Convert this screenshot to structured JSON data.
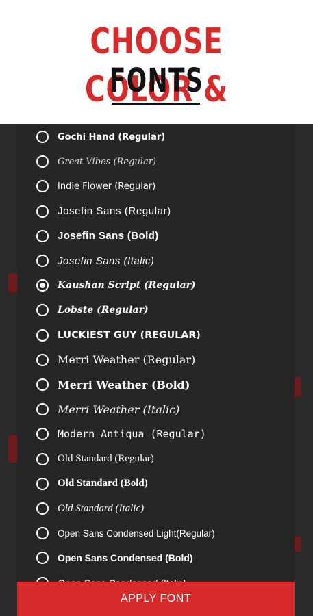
{
  "header": {
    "title_line1": "CHOOSE COLOR &",
    "title_line2": "FONTS"
  },
  "dialog": {
    "fonts": [
      {
        "label": "Gochi Hand (Regular)",
        "selected": false
      },
      {
        "label": "Great Vibes (Regular)",
        "selected": false
      },
      {
        "label": "Indie Flower (Regular)",
        "selected": false
      },
      {
        "label": "Josefin Sans (Regular)",
        "selected": false
      },
      {
        "label": "Josefin Sans (Bold)",
        "selected": false
      },
      {
        "label": "Josefin Sans (Italic)",
        "selected": false
      },
      {
        "label": "Kaushan Script (Regular)",
        "selected": true
      },
      {
        "label": "Lobste (Regular)",
        "selected": false
      },
      {
        "label": "LUCKIEST GUY (REGULAR)",
        "selected": false
      },
      {
        "label": "Merri Weather (Regular)",
        "selected": false
      },
      {
        "label": "Merri Weather (Bold)",
        "selected": false
      },
      {
        "label": "Merri Weather (Italic)",
        "selected": false
      },
      {
        "label": "Modern Antiqua (Regular)",
        "selected": false
      },
      {
        "label": "Old Standard (Regular)",
        "selected": false
      },
      {
        "label": "Old Standard (Bold)",
        "selected": false
      },
      {
        "label": "Old Standard (Italic)",
        "selected": false
      },
      {
        "label": "Open Sans Condensed Light(Regular)",
        "selected": false
      },
      {
        "label": "Open Sans Condensed (Bold)",
        "selected": false
      },
      {
        "label": "Open Sans Condensed (Italic)",
        "selected": false
      }
    ],
    "apply_label": "APPLY FONT"
  },
  "colors": {
    "accent": "#d72b2b",
    "dialog_bg": "#262626"
  }
}
